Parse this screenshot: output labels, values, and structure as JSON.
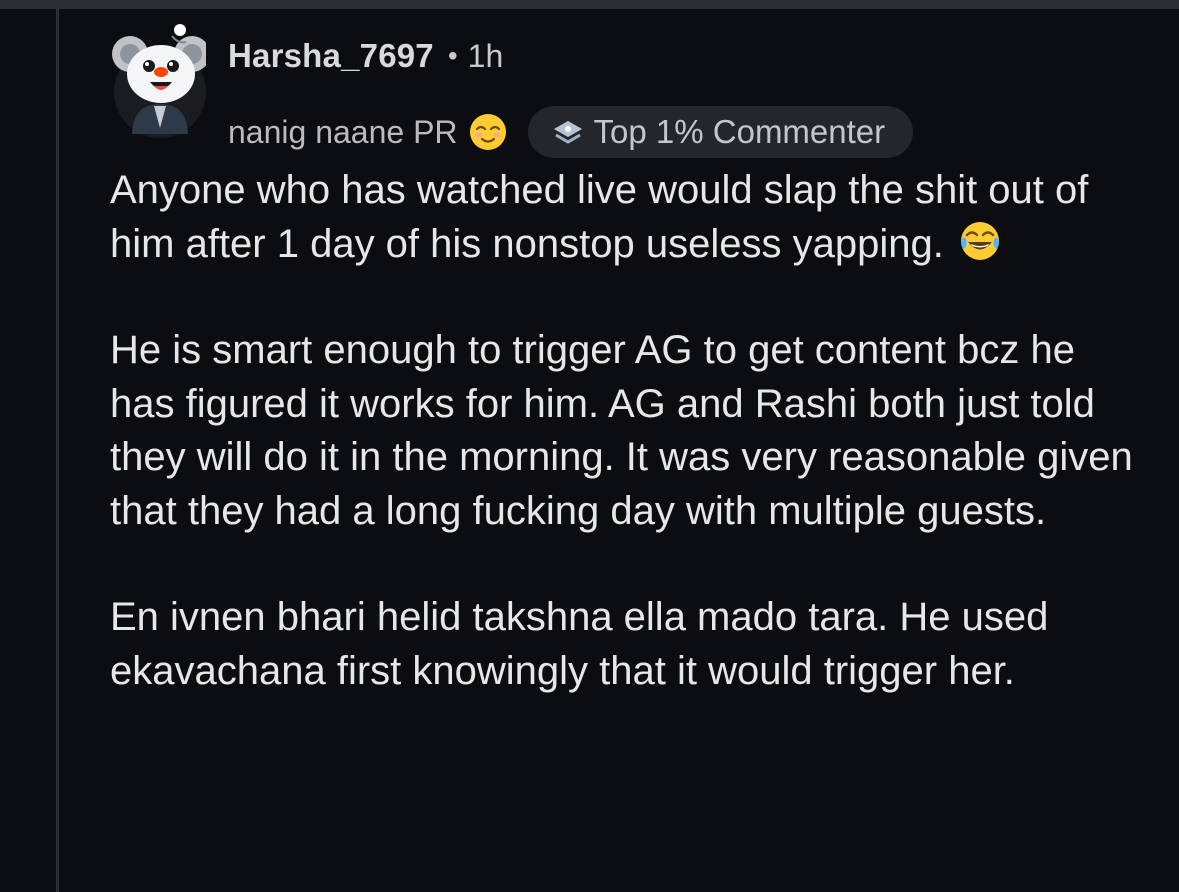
{
  "comment": {
    "username": "Harsha_7697",
    "separator": "•",
    "time": "1h",
    "flair": "nanig naane PR",
    "flair_emoji": "relieved-face-emoji",
    "badge": {
      "icon": "comment-badge-icon",
      "label": "Top 1% Commenter"
    },
    "paragraphs": [
      "Anyone who has watched live would slap the shit out of him after 1 day of his nonstop useless yapping.",
      "He is smart enough to trigger AG to get content bcz he has figured it works for him. AG and Rashi both just told they will do it in the morning. It was very reasonable given that they had a long fucking day with multiple guests.",
      "En ivnen bhari helid takshna ella mado tara. He used ekavachana first knowingly that it would trigger her."
    ],
    "paragraph1_emoji": "tears-of-joy-emoji"
  },
  "colors": {
    "background": "#0b0d10",
    "text": "#e6e7e8",
    "muted": "#b9bcbf",
    "badge_bg": "#23272c",
    "thread_line": "#2b2f34"
  }
}
